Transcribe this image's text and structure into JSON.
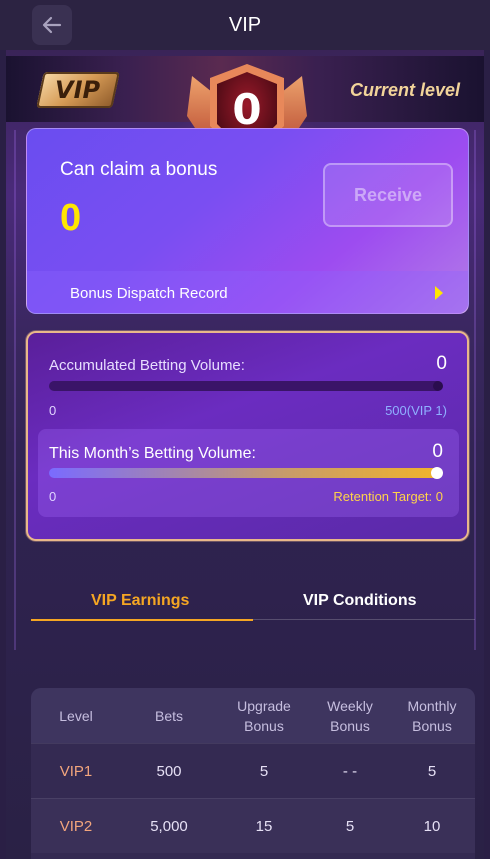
{
  "header": {
    "title": "VIP",
    "back_icon": "back-arrow-icon"
  },
  "hero": {
    "logo_text": "VIP",
    "badge_level": "0",
    "current_level_label": "Current level"
  },
  "bonus": {
    "title": "Can claim a bonus",
    "amount": "0",
    "receive_label": "Receive",
    "dispatch_label": "Bonus Dispatch Record"
  },
  "betting": {
    "accumulated_label": "Accumulated Betting Volume:",
    "accumulated_value": "0",
    "accumulated_progress": 0,
    "accumulated_min": "0",
    "accumulated_max": "500(VIP 1)",
    "month_label": "This Month’s Betting Volume:",
    "month_value": "0",
    "month_min": "0",
    "retention_target": "Retention Target: 0"
  },
  "tabs": [
    {
      "label": "VIP Earnings",
      "active": true
    },
    {
      "label": "VIP Conditions",
      "active": false
    }
  ],
  "table": {
    "headers": [
      "Level",
      "Bets",
      "Upgrade Bonus",
      "Weekly Bonus",
      "Monthly Bonus"
    ],
    "rows": [
      [
        "VIP1",
        "500",
        "5",
        "- -",
        "5"
      ],
      [
        "VIP2",
        "5,000",
        "15",
        "5",
        "10"
      ]
    ]
  },
  "colors": {
    "accent": "#f5a623",
    "amount": "#ffe600",
    "level_text": "#f2a57d"
  }
}
